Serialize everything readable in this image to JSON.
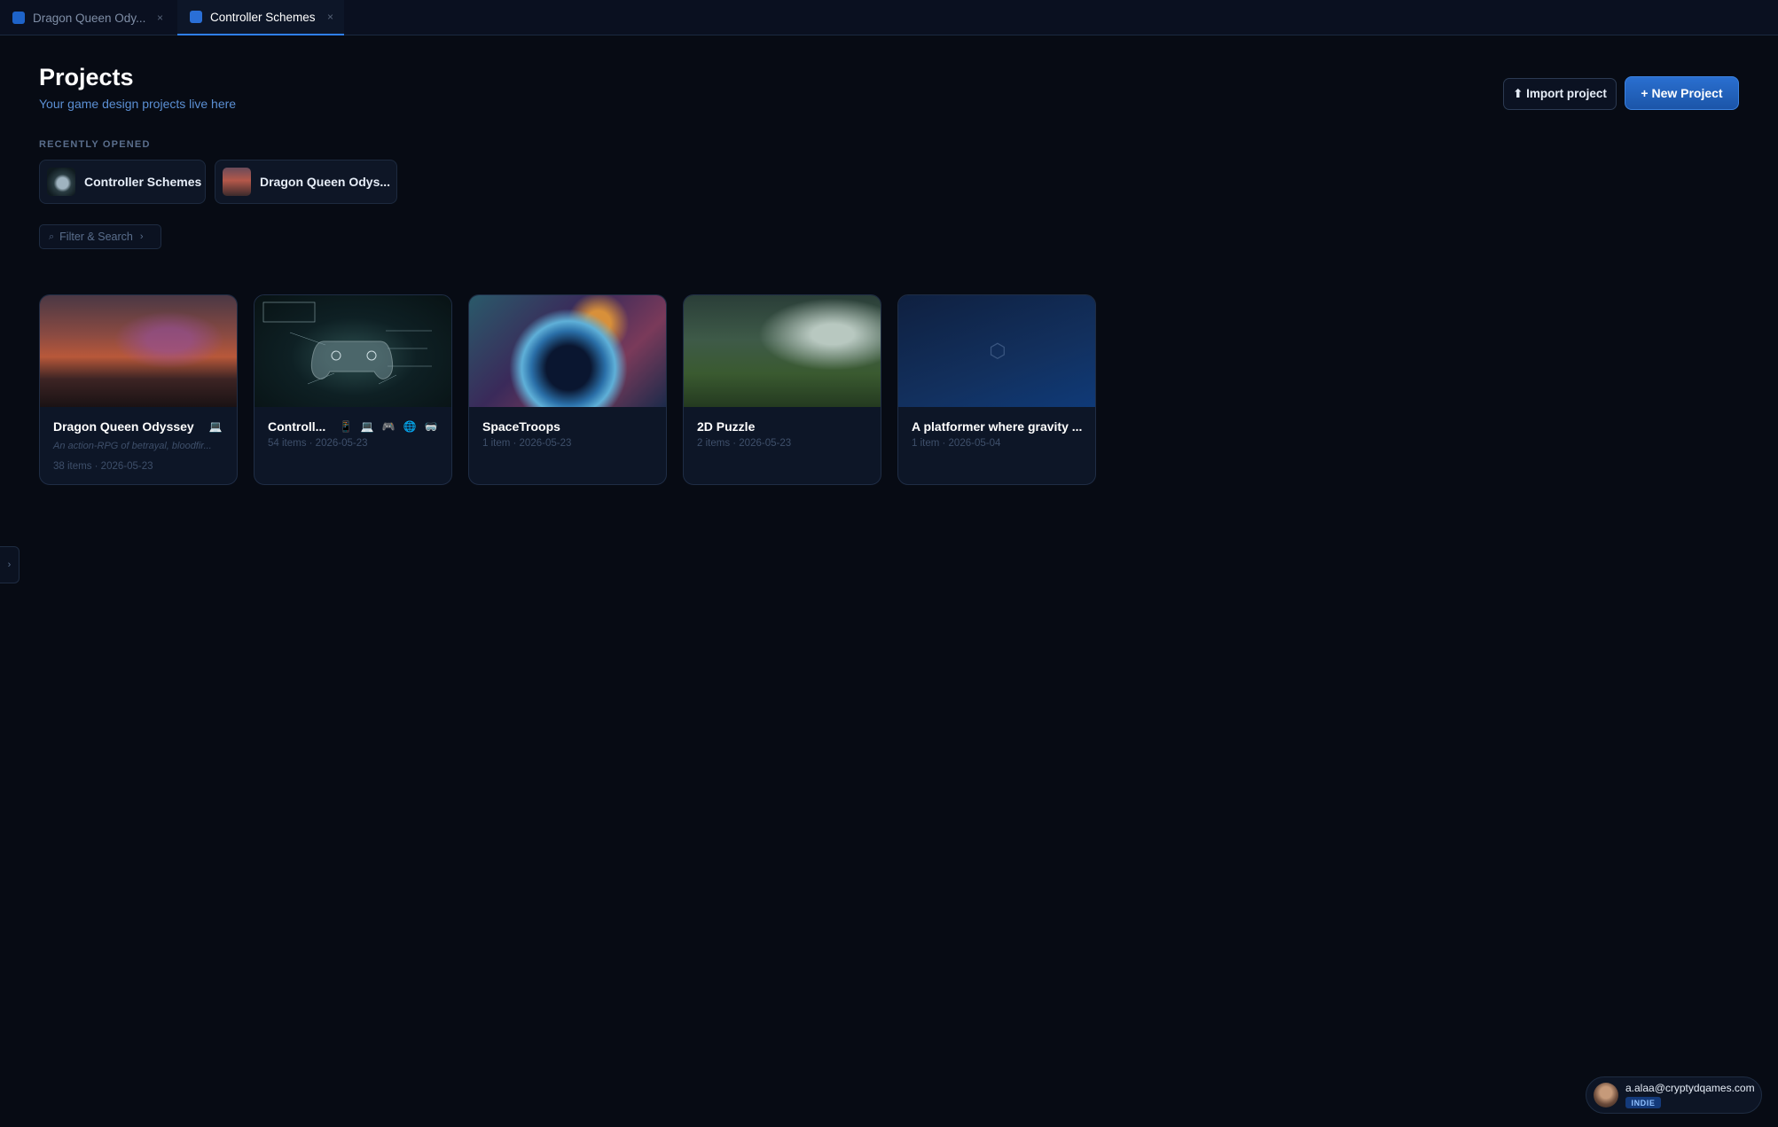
{
  "tabs": [
    {
      "label": "Dragon Queen Ody...",
      "close": "×"
    },
    {
      "label": "Controller Schemes",
      "close": "×"
    }
  ],
  "header": {
    "title": "Projects",
    "subtitle": "Your game design projects live here",
    "import_label": "⬆ Import project",
    "new_label": "+ New Project"
  },
  "recent": {
    "section_label": "RECENTLY OPENED",
    "items": [
      {
        "label": "Controller Schemes"
      },
      {
        "label": "Dragon Queen Odys..."
      }
    ]
  },
  "filter": {
    "label": "Filter & Search",
    "icon": "⌕",
    "chevron": "›"
  },
  "projects": [
    {
      "title": "Dragon Queen Odyssey",
      "description": "An action-RPG of betrayal, bloodfir...",
      "meta": "38 items · 2026-05-23",
      "platforms": [
        "💻"
      ]
    },
    {
      "title": "Controll...",
      "meta": "54 items · 2026-05-23",
      "platforms": [
        "📱",
        "💻",
        "🎮",
        "🌐",
        "🥽"
      ]
    },
    {
      "title": "SpaceTroops",
      "meta": "1 item · 2026-05-23",
      "platforms": []
    },
    {
      "title": "2D Puzzle",
      "meta": "2 items · 2026-05-23",
      "platforms": []
    },
    {
      "title": "A platformer where gravity ...",
      "meta": "1 item · 2026-05-04",
      "platforms": [],
      "placeholder_icon": "⬡"
    }
  ],
  "sidebar_toggle": "›",
  "user": {
    "email": "a.alaa@cryptydqames.com",
    "plan": "INDIE"
  },
  "colors": {
    "accent": "#2a6fd0",
    "background": "#070b14",
    "card": "#0d1627"
  }
}
